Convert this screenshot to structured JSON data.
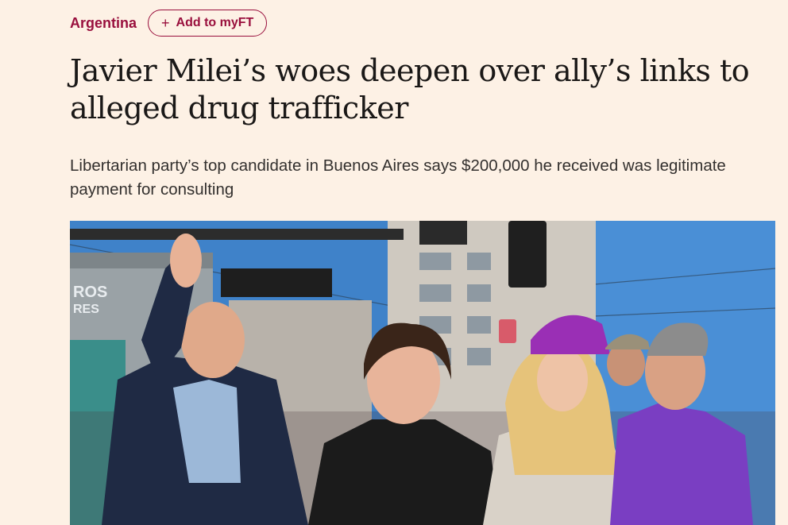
{
  "topic": {
    "label": "Argentina"
  },
  "myft": {
    "plus_icon": "+",
    "label": "Add to myFT"
  },
  "article": {
    "headline": "Javier Milei’s woes deepen over ally’s links to alleged drug trafficker",
    "standfirst": "Libertarian party’s top candidate in Buenos Aires says $200,000 he received was legitimate payment for consulting"
  },
  "photo": {
    "sign_lines": [
      "ROS",
      "RES"
    ]
  },
  "colors": {
    "background": "#fdf1e5",
    "accent": "#990f3d",
    "headline": "#1a1817",
    "body": "#33302e"
  }
}
